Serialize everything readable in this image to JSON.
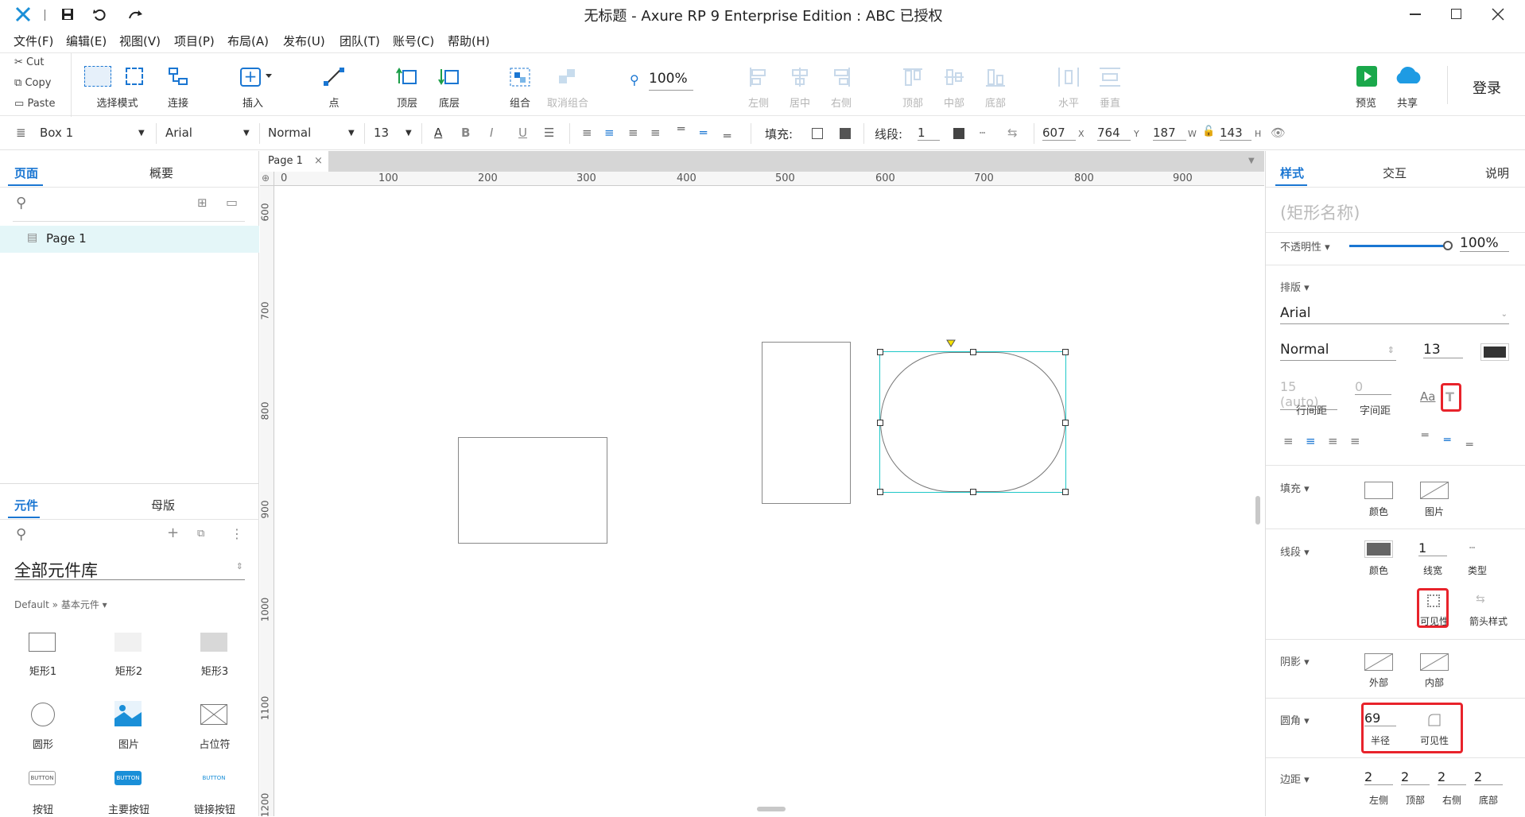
{
  "window": {
    "title": "无标题 - Axure RP 9 Enterprise Edition : ABC 已授权"
  },
  "menu": [
    "文件(F)",
    "编辑(E)",
    "视图(V)",
    "项目(P)",
    "布局(A)",
    "发布(U)",
    "团队(T)",
    "账号(C)",
    "帮助(H)"
  ],
  "clipboard": {
    "cut": "Cut",
    "copy": "Copy",
    "paste": "Paste"
  },
  "toolbar": {
    "select_mode": "选择模式",
    "connect": "连接",
    "insert": "插入",
    "point": "点",
    "top_layer": "顶层",
    "bottom_layer": "底层",
    "group": "组合",
    "ungroup": "取消组合",
    "zoom": "100%",
    "align_left": "左侧",
    "align_center": "居中",
    "align_right": "右侧",
    "align_top": "顶部",
    "align_middle": "中部",
    "align_bottom": "底部",
    "dist_h": "水平",
    "dist_v": "垂直",
    "preview": "预览",
    "share": "共享",
    "login": "登录"
  },
  "format": {
    "widget_name": "Box 1",
    "font": "Arial",
    "weight": "Normal",
    "size": "13",
    "fill_label": "填充:",
    "stroke_label": "线段:",
    "stroke_width": "1",
    "x": "607",
    "x_l": "X",
    "y": "764",
    "y_l": "Y",
    "w": "187",
    "w_l": "W",
    "h": "143",
    "h_l": "H"
  },
  "pages_panel": {
    "tab_pages": "页面",
    "tab_outline": "概要",
    "page": "Page 1"
  },
  "lib_panel": {
    "tab_widgets": "元件",
    "tab_masters": "母版",
    "library": "全部元件库",
    "breadcrumb": "Default » 基本元件 ▾",
    "items": [
      "矩形1",
      "矩形2",
      "矩形3",
      "圆形",
      "图片",
      "占位符",
      "按钮",
      "主要按钮",
      "链接按钮"
    ]
  },
  "canvas": {
    "tab": "Page 1",
    "hticks": [
      "0",
      "100",
      "200",
      "300",
      "400",
      "500",
      "600",
      "700",
      "800",
      "900"
    ],
    "vticks": [
      "600",
      "700",
      "800",
      "900",
      "1000",
      "1100",
      "1200"
    ]
  },
  "inspector": {
    "tab_style": "样式",
    "tab_interact": "交互",
    "tab_notes": "说明",
    "shape_name": "(矩形名称)",
    "opacity_label": "不透明性 ▾",
    "opacity": "100%",
    "typo_label": "排版 ▾",
    "font": "Arial",
    "weight": "Normal",
    "size": "13",
    "line_spacing": "15 (auto)",
    "line_spacing_l": "行间距",
    "char_spacing": "0",
    "char_spacing_l": "字间距",
    "text_aa": "Aa",
    "fill_label": "填充 ▾",
    "fill_color": "颜色",
    "fill_image": "图片",
    "stroke_label": "线段 ▾",
    "stroke_color": "颜色",
    "stroke_width": "1",
    "stroke_width_l": "线宽",
    "stroke_type": "类型",
    "stroke_visibility": "可见性",
    "arrow_style": "箭头样式",
    "shadow_label": "阴影 ▾",
    "shadow_outer": "外部",
    "shadow_inner": "内部",
    "radius_label": "圆角 ▾",
    "radius": "69",
    "radius_l": "半径",
    "radius_visibility": "可见性",
    "padding_label": "边距 ▾",
    "pad_left": "2",
    "pad_top": "2",
    "pad_right": "2",
    "pad_bottom": "2",
    "pad_left_l": "左侧",
    "pad_top_l": "顶部",
    "pad_right_l": "右侧",
    "pad_bottom_l": "底部"
  },
  "colors": {
    "accent": "#1a76d2",
    "highlight": "#e8232b",
    "selection": "#1ec8c8"
  }
}
